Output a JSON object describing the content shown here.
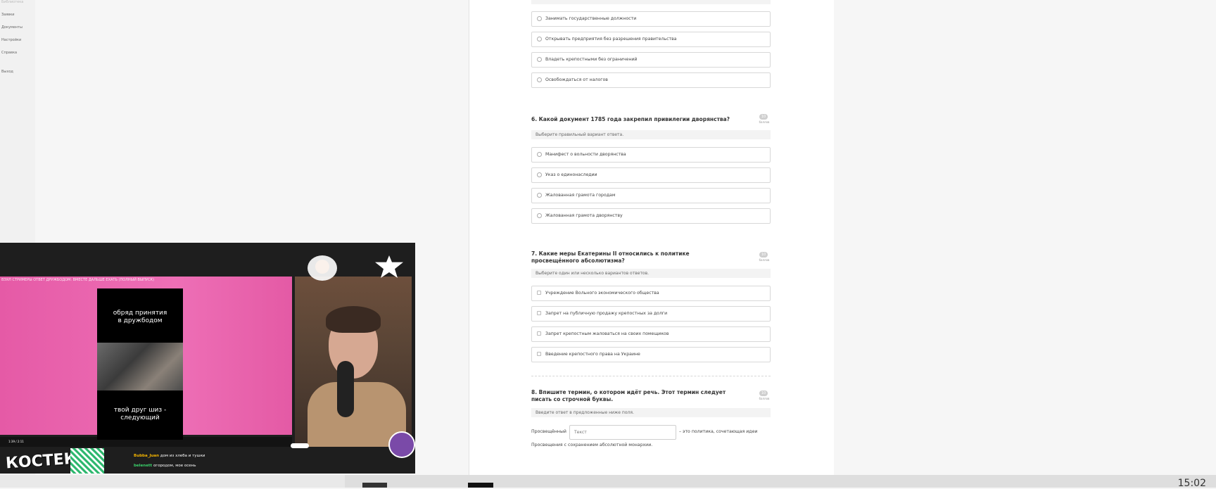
{
  "sidebar": {
    "items": [
      {
        "label": "Библиотека",
        "dim": true
      },
      {
        "label": "Заявки"
      },
      {
        "label": "Документы"
      },
      {
        "label": "Настройки"
      },
      {
        "label": "Справка"
      },
      {
        "label": "Выход"
      }
    ]
  },
  "quiz": {
    "q5_options": [
      "Занимать государственные должности",
      "Открывать предприятия без разрешения правительства",
      "Владеть крепостными без ограничений",
      "Освобождаться от налогов"
    ],
    "q6": {
      "title": "6. Какой документ 1785 года закрепил привилегии дворянства?",
      "points": "10",
      "points_label": "баллов",
      "hint": "Выберите правильный вариант ответа.",
      "options": [
        "Манифест о вольности дворянства",
        "Указ о единонаследии",
        "Жалованная грамота городам",
        "Жалованная грамота дворянству"
      ]
    },
    "q7": {
      "title": "7. Какие меры Екатерины II относились к политике просвещённого абсолютизма?",
      "points": "10",
      "points_label": "баллов",
      "hint": "Выберите один или несколько вариантов ответов.",
      "options": [
        "Учреждение Вольного экономического общества",
        "Запрет на публичную продажу крепостных за долги",
        "Запрет крепостным жаловаться на своих помещиков",
        "Введение крепостного права на Украине"
      ]
    },
    "q8": {
      "title": "8. Впишите термин, о котором идёт речь. Этот термин следует писать со строчной буквы.",
      "points": "10",
      "points_label": "баллов",
      "hint": "Введите ответ в предложенные ниже поля.",
      "prefix": "Просвещённый",
      "input_placeholder": "Текст",
      "suffix": "– это политика, сочетающая идеи",
      "line2": "Просвещения с сохранением абсолютной монархии."
    }
  },
  "overlay": {
    "video_title": "ВЗЯЛ СТРИМЕРЫ ОТВЕТ ДРУЖБОДОМ: ВМЕСТЕ ДАЛЬШЕ ЕХАТЬ (ПОЛНЫЙ ВЫПУСК)",
    "phone_top": "обряд принятия\nв дружбодом",
    "phone_bottom": "твой друг шиз -\nследующий",
    "player_time": "1:39 / 2:11",
    "logo": "КОСТЕК",
    "chat": [
      {
        "user": "Bubba_Juan",
        "user_color": "#f4b400",
        "text": "дом из хлеба и тушки"
      },
      {
        "user": "belenett",
        "user_color": "#3ad16a",
        "text": "огородом, мое осень"
      }
    ]
  },
  "taskbar": {
    "clock": "15:02"
  }
}
